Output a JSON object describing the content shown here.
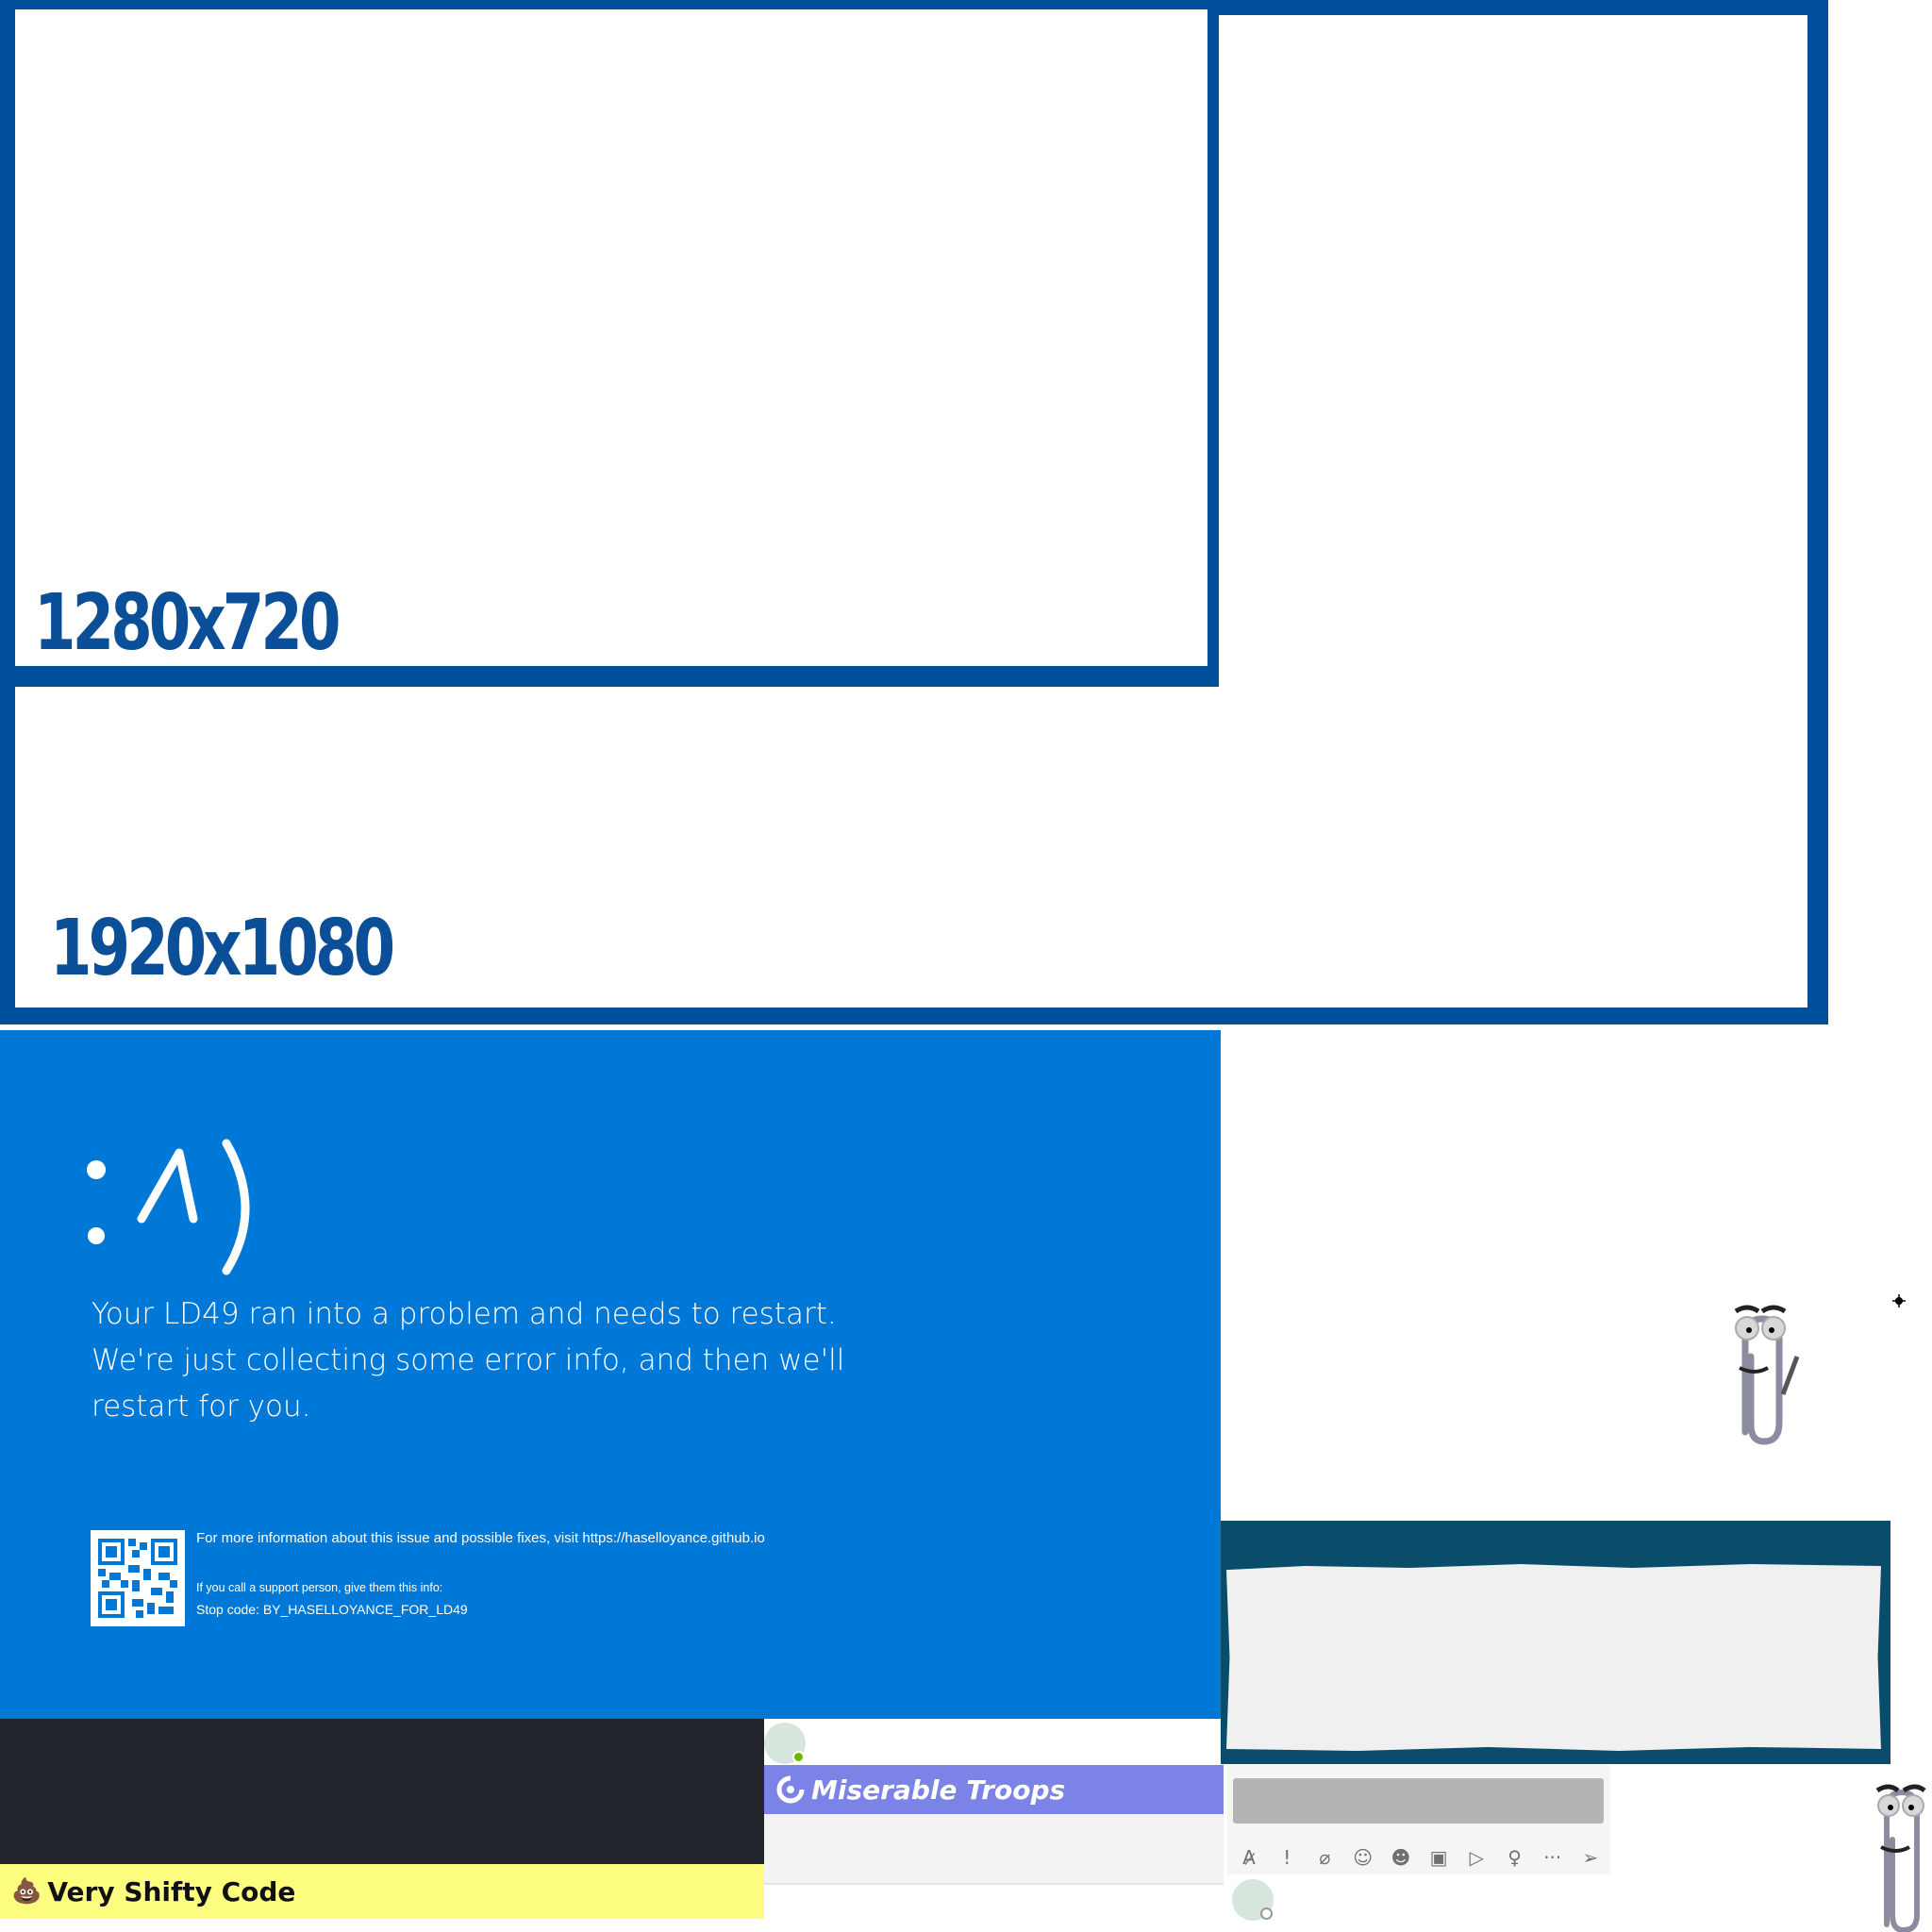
{
  "resolutions": {
    "large_label": "1920x1080",
    "small_label": "1280x720"
  },
  "bsod": {
    "face": ":^)",
    "message": "Your LD49 ran into a problem and needs to restart. We're just collecting some error info, and then we'll restart for you.",
    "info_line": "For more information about this issue and possible fixes, visit https://haselloyance.github.io",
    "support_line": "If you call a support person, give them this info:",
    "stop_code": "Stop code: BY_HASELLOYANCE_FOR_LD49",
    "background_color": "#0078d7"
  },
  "app": {
    "title": "Very Shifty Code",
    "title_icon": "poop-icon",
    "title_bar_color": "#fcfc7e"
  },
  "chat": {
    "team_name": "Miserable Troops",
    "team_icon": "teams-swirl-icon",
    "team_bar_color": "#7b83e6",
    "toolbar_icons": [
      "format-icon",
      "important-icon",
      "attach-icon",
      "emoji-icon",
      "sticker-icon",
      "schedule-icon",
      "stream-icon",
      "praise-icon",
      "more-icon",
      "send-icon"
    ],
    "toolbar_glyphs": [
      "A̷",
      "!",
      "⌀",
      "☺",
      "☻",
      "▣",
      "▷",
      "♀",
      "···",
      "➢"
    ]
  },
  "assistant": {
    "name_icon": "clippy-icon"
  },
  "brand_color": "#004f9a",
  "dialog_color": "#0a4d6b"
}
